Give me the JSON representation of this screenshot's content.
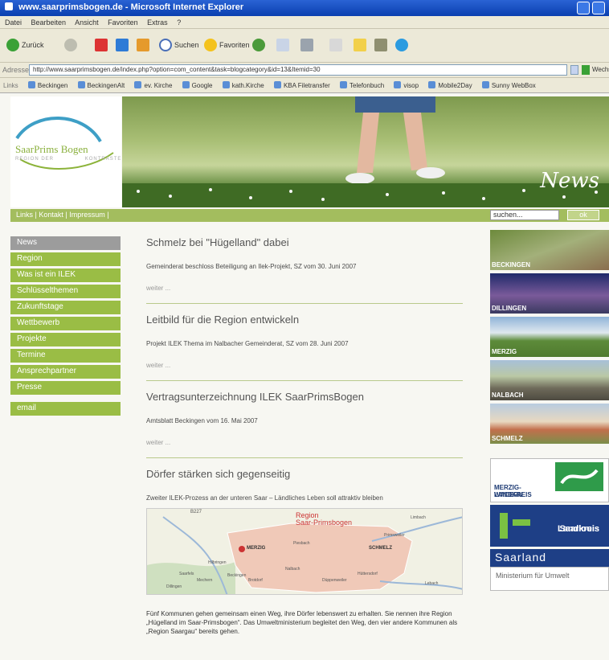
{
  "window": {
    "title": "www.saarprimsbogen.de - Microsoft Internet Explorer"
  },
  "menu_bar": [
    "Datei",
    "Bearbeiten",
    "Ansicht",
    "Favoriten",
    "Extras",
    "?"
  ],
  "toolbar": {
    "back": "Zurück",
    "search": "Suchen",
    "favorites": "Favoriten"
  },
  "address": {
    "label": "Adresse",
    "url": "http://www.saarprimsbogen.de/index.php?option=com_content&task=blogcategory&id=13&Itemid=30",
    "go": "Wechseln"
  },
  "links_bar": {
    "label": "Links",
    "items": [
      "Beckingen",
      "BeckingenAlt",
      "ev. Kirche",
      "Google",
      "kath.Kirche",
      "KBA Filetransfer",
      "Telefonbuch",
      "visop",
      "Mobile2Day",
      "Sunny WebBox"
    ]
  },
  "site": {
    "logo": {
      "name1": "SaarPrims",
      "name2": "Bogen",
      "tag1": "REGION DER",
      "tag2": "KONTRASTE"
    },
    "banner_title": "News",
    "top_links": "Links | Kontakt | Impressum |",
    "search_placeholder": "suchen...",
    "ok_label": "ok",
    "menu": [
      "News",
      "Region",
      "Was ist ein ILEK",
      "Schlüsselthemen",
      "Zukunftstage",
      "Wettbewerb",
      "Projekte",
      "Termine",
      "Ansprechpartner",
      "Presse"
    ],
    "email_label": "email",
    "articles": [
      {
        "title": "Schmelz bei \"Hügelland\" dabei",
        "subtitle": "Gemeinderat beschloss Beteiligung an Ilek-Projekt, SZ vom 30. Juni 2007",
        "more": "weiter ..."
      },
      {
        "title": "Leitbild für die Region entwickeln",
        "subtitle": "Projekt ILEK Thema im Nalbacher Gemeinderat, SZ vom 28. Juni 2007",
        "more": "weiter ..."
      },
      {
        "title": "Vertragsunterzeichnung ILEK SaarPrimsBogen",
        "subtitle": "Amtsblatt Beckingen vom 16. Mai 2007",
        "more": "weiter ..."
      },
      {
        "title": "Dörfer stärken sich gegenseitig",
        "subtitle": "Zweiter ILEK-Prozess an der unteren Saar – Ländliches Leben soll attraktiv bleiben",
        "more": ""
      }
    ],
    "map": {
      "title1": "Region",
      "title2": "Saar-Primsbogen",
      "road": "B227",
      "places": [
        "MERZIG",
        "SCHMELZ",
        "Primsweiler",
        "Piesbach",
        "Nalbach",
        "Düppenweiler",
        "Beckingen",
        "Saarfels",
        "Hilbringen",
        "Mechern",
        "Brotdorf",
        "Dillingen",
        "Limbach",
        "Lebach",
        "Hüttersdorf"
      ]
    },
    "body_text": "Fünf Kommunen gehen gemeinsam einen Weg, ihre Dörfer lebenswert zu erhalten. Sie nennen ihre Region „Hügelland im Saar-Primsbogen“. Das Umweltministerium begleitet den Weg, den vier andere Kommunen als „Region Saargau“ bereits gehen.",
    "towns": [
      "BECKINGEN",
      "DILLINGEN",
      "MERZIG",
      "NALBACH",
      "SCHMELZ"
    ],
    "partners": {
      "lk_merzig_1": "LANDKREIS",
      "lk_merzig_2": "MERZIG-WADERN",
      "lk_saarlouis_1": "Landkreis",
      "lk_saarlouis_2": "Saarlouis",
      "saarland": "Saarland",
      "ministry": "Ministerium für Umwelt"
    }
  }
}
